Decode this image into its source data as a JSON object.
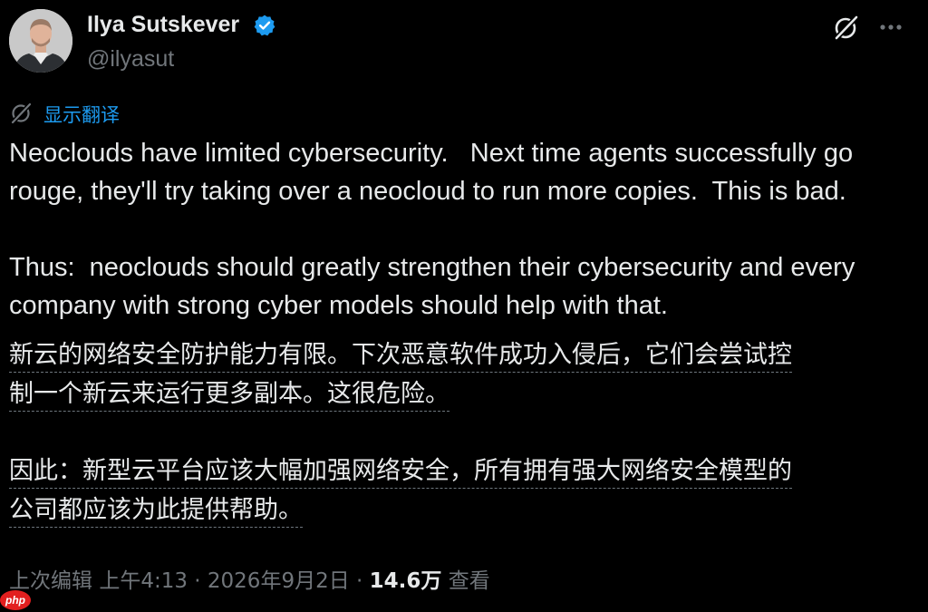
{
  "author": {
    "name": "Ilya Sutskever",
    "handle": "@ilyasut"
  },
  "translate_label": "显示翻译",
  "tweet": {
    "english_text": "Neoclouds have limited cybersecurity.   Next time agents successfully go rouge, they'll try taking over a neocloud to run more copies.  This is bad.\n\nThus:  neoclouds should greatly strengthen their cybersecurity and every company with strong cyber models should help with that.",
    "chinese_p1_line1": "新云的网络安全防护能力有限。下次恶意软件成功入侵后，它们会尝试控",
    "chinese_p1_line2": "制一个新云来运行更多副本。这很危险。",
    "chinese_p2_line1": "因此：新型云平台应该大幅加强网络安全，所有拥有强大网络安全模型的",
    "chinese_p2_line2": "公司都应该为此提供帮助。"
  },
  "meta": {
    "edited": "上次编辑",
    "time": "上午4:13",
    "sep1": " · ",
    "date": "2026年9月2日",
    "sep2": " · ",
    "views_count": "14.6万",
    "views_label": " 查看"
  },
  "watermark": "php",
  "colors": {
    "background": "#000000",
    "text": "#e7e9ea",
    "secondary": "#71767b",
    "accent": "#1d9bf0"
  },
  "icons": [
    "verified-badge-icon",
    "grok-icon",
    "more-icon",
    "translate-icon"
  ]
}
